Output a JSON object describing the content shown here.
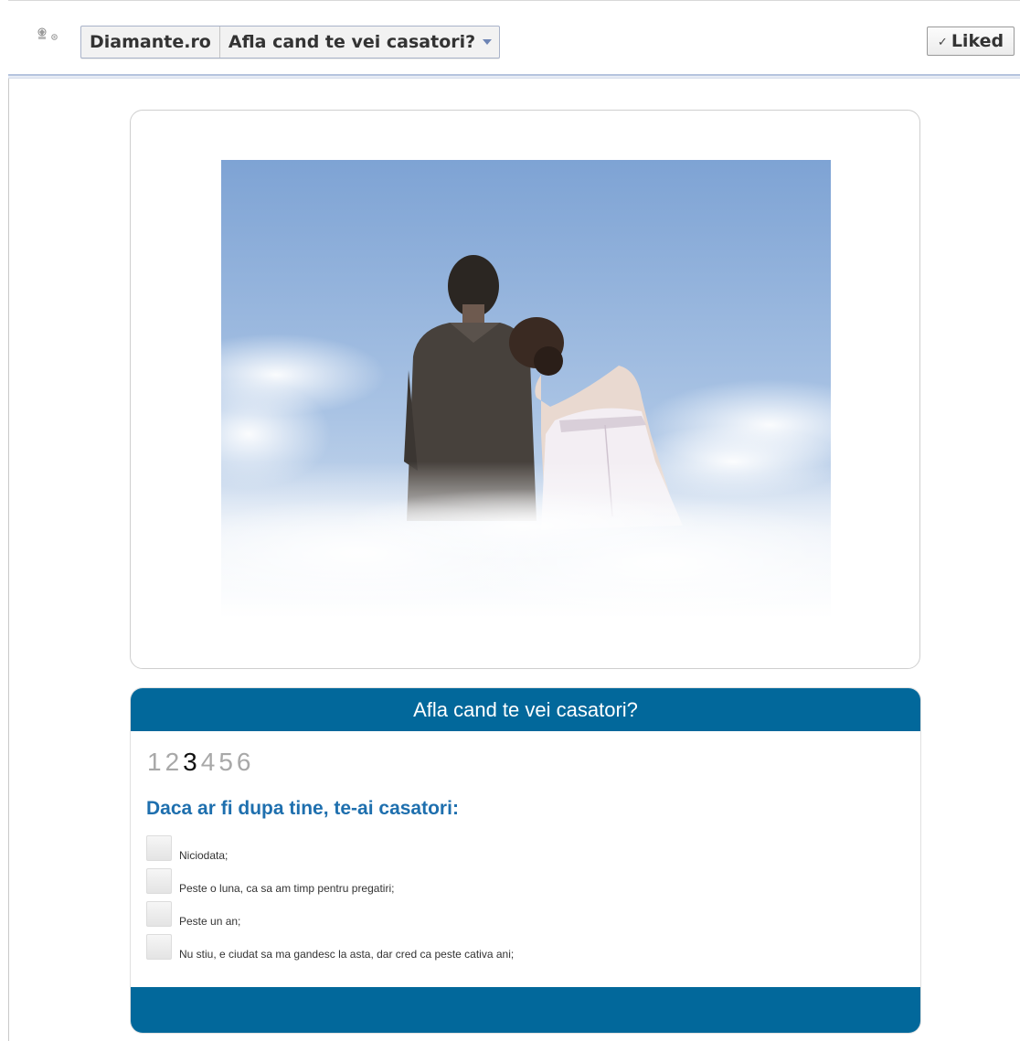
{
  "header": {
    "logo": {
      "line1": "Diamante.ro",
      "line2": "Diamante.ro"
    },
    "page_name": "Diamante.ro",
    "app_title": "Afla cand te vei casatori?",
    "liked_label": "Liked",
    "liked_check": "✓"
  },
  "quiz": {
    "title": "Afla cand te vei casatori?",
    "steps": [
      "1",
      "2",
      "3",
      "4",
      "5",
      "6"
    ],
    "current_step": "3",
    "question": "Daca ar fi dupa tine, te-ai casatori:",
    "options": [
      "Niciodata;",
      "Peste o luna, ca sa am timp pentru pregatiri;",
      "Peste un an;",
      "Nu stiu, e ciudat sa ma gandesc la asta, dar cred ca peste cativa ani;"
    ]
  },
  "colors": {
    "quiz_bar": "#02689b",
    "question_text": "#1e6fae",
    "header_line": "#b5c4de"
  }
}
